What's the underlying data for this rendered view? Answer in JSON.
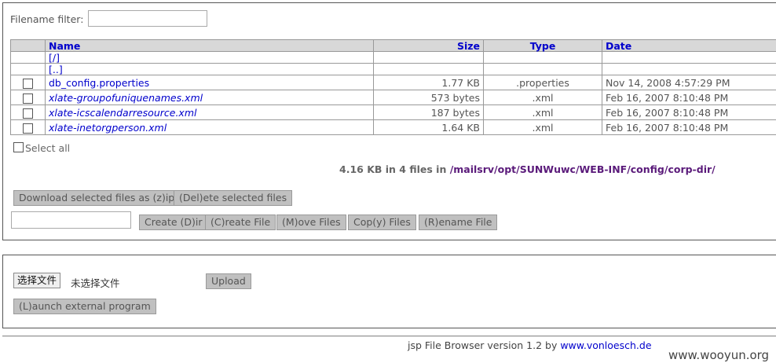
{
  "filter": {
    "label": "Filename filter:",
    "value": ""
  },
  "table": {
    "headers": {
      "name": "Name",
      "size": "Size",
      "type": "Type",
      "date": "Date"
    },
    "dirs": [
      "[/]",
      "[..]"
    ],
    "files": [
      {
        "name": "db_config.properties",
        "size": "1.77 KB",
        "type": ".properties",
        "date": "Nov 14, 2008 4:57:29 PM",
        "italic": false
      },
      {
        "name": "xlate-groupofuniquenames.xml",
        "size": "573 bytes",
        "type": ".xml",
        "date": "Feb 16, 2007 8:10:48 PM",
        "italic": true
      },
      {
        "name": "xlate-icscalendarresource.xml",
        "size": "187 bytes",
        "type": ".xml",
        "date": "Feb 16, 2007 8:10:48 PM",
        "italic": true
      },
      {
        "name": "xlate-inetorgperson.xml",
        "size": "1.64 KB",
        "type": ".xml",
        "date": "Feb 16, 2007 8:10:48 PM",
        "italic": true
      }
    ]
  },
  "select_all": "Select all",
  "summary": {
    "text": "4.16 KB in 4 files in ",
    "path": "/mailsrv/opt/SUNWuwc/WEB-INF/config/corp-dir/"
  },
  "buttons": {
    "download_zip": "Download selected files as (z)ip",
    "delete": "(Del)ete selected files",
    "create_dir": "Create (D)ir",
    "create_file": "(C)reate File",
    "move": "(M)ove Files",
    "copy": "Cop(y) Files",
    "rename": "(R)ename File"
  },
  "upload": {
    "choose_label": "选择文件",
    "no_file": "未选择文件",
    "upload_button": "Upload",
    "launch_button": "(L)aunch external program"
  },
  "footer": {
    "text": "jsp File Browser version 1.2 by ",
    "link": "www.vonloesch.de"
  },
  "watermark": "www.wooyun.org",
  "colors": {
    "link": "#0000cc",
    "path": "#5a1a7a",
    "button_bg": "#c0c0c0",
    "header_bg": "#d8d8d8"
  }
}
